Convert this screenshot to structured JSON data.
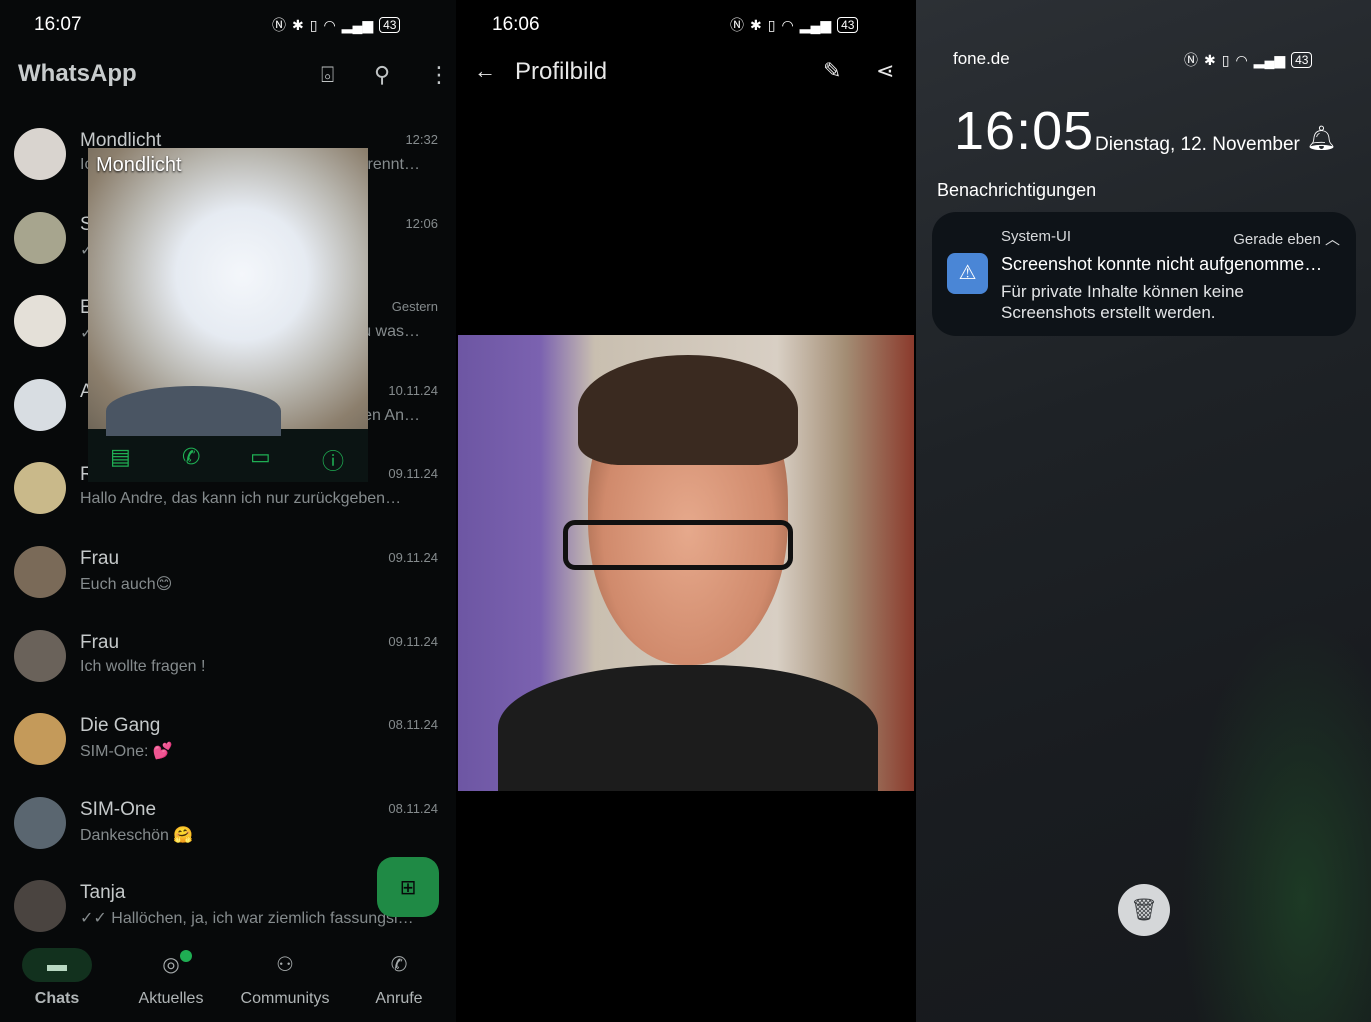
{
  "whatsapp": {
    "status": {
      "time": "16:07",
      "battery": "43"
    },
    "title": "WhatsApp",
    "icons": [
      "camera-icon",
      "search-icon",
      "more-vert-icon"
    ],
    "chats": [
      {
        "name": "Mondlicht",
        "preview": "Ic",
        "preview_end": "rennt…",
        "date": "12:32",
        "avatar_color": "#d9d4cf"
      },
      {
        "name": "S",
        "preview": "✓",
        "preview_end": "",
        "date": "12:06",
        "avatar_color": "#a7a58e"
      },
      {
        "name": "E",
        "preview": "✓",
        "preview_end": "u was…",
        "date": "Gestern",
        "avatar_color": "#e4e0d8"
      },
      {
        "name": "A",
        "preview": "",
        "preview_end": "en An…",
        "date": "10.11.24",
        "avatar_color": "#d8dde2"
      },
      {
        "name": "R…",
        "preview": "Hallo Andre, das kann ich nur zurückgeben…",
        "preview_end": "",
        "date": "09.11.24",
        "avatar_color": "#c9b98a"
      },
      {
        "name": "Frau",
        "preview": "Euch auch😊",
        "preview_end": "",
        "date": "09.11.24",
        "avatar_color": "#7a6a58"
      },
      {
        "name": "Frau",
        "preview": "Ich wollte fragen !",
        "preview_end": "",
        "date": "09.11.24",
        "avatar_color": "#6a625a"
      },
      {
        "name": "Die Gang",
        "preview": "SIM-One: 💕",
        "preview_end": "",
        "date": "08.11.24",
        "avatar_color": "#c49a5a"
      },
      {
        "name": "SIM-One",
        "preview": "Dankeschön 🤗",
        "preview_end": "",
        "date": "08.11.24",
        "avatar_color": "#5a6670"
      },
      {
        "name": "Tanja",
        "preview": "✓✓ Hallöchen,  ja, ich war ziemlich fassungsl…",
        "preview_end": "",
        "date": "",
        "avatar_color": "#4a4440"
      }
    ],
    "popup": {
      "title": "Mondlicht",
      "actions": [
        "message-icon",
        "call-icon",
        "video-call-icon",
        "info-icon"
      ]
    },
    "nav": [
      {
        "label": "Chats",
        "icon": "chats-icon",
        "active": true
      },
      {
        "label": "Aktuelles",
        "icon": "status-icon",
        "badge": true
      },
      {
        "label": "Communitys",
        "icon": "communities-icon"
      },
      {
        "label": "Anrufe",
        "icon": "calls-icon"
      }
    ],
    "accent": "#1fae53"
  },
  "profile": {
    "status": {
      "time": "16:06",
      "battery": "43"
    },
    "title": "Profilbild",
    "icons": [
      "back-arrow-icon",
      "edit-pencil-icon",
      "share-icon"
    ]
  },
  "lockscreen": {
    "status": {
      "carrier": "fone.de",
      "battery": "43"
    },
    "clock": "16:05",
    "date": "Dienstag, 12. November",
    "notifications_heading": "Benachrichtigungen",
    "notification": {
      "app": "System-UI",
      "time": "Gerade eben",
      "title": "Screenshot konnte nicht aufgenomme…",
      "body": "Für private Inhalte können keine Screenshots erstellt werden."
    }
  }
}
